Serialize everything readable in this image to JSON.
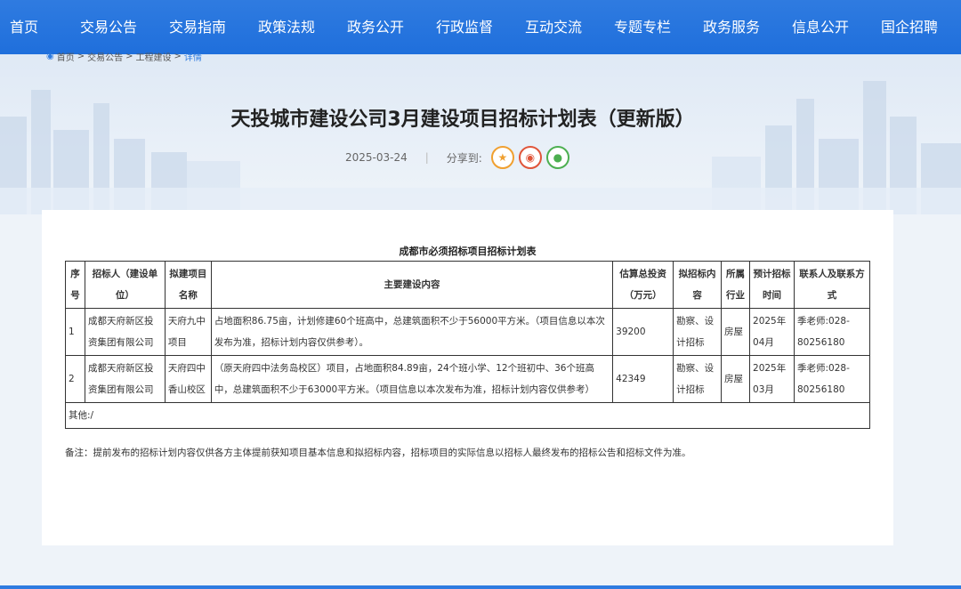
{
  "nav": {
    "items": [
      {
        "label": "首页"
      },
      {
        "label": "交易公告"
      },
      {
        "label": "交易指南"
      },
      {
        "label": "政策法规"
      },
      {
        "label": "政务公开"
      },
      {
        "label": "行政监督"
      },
      {
        "label": "互动交流"
      },
      {
        "label": "专题专栏"
      },
      {
        "label": "政务服务"
      },
      {
        "label": "信息公开"
      },
      {
        "label": "国企招聘"
      }
    ],
    "bg_color": "#2f7be0"
  },
  "breadcrumb": {
    "items": [
      "首页",
      "交易公告",
      "工程建设"
    ],
    "sep": ">",
    "current": "详情"
  },
  "article": {
    "title": "天投城市建设公司3月建设项目招标计划表（更新版）",
    "date": "2025-03-24",
    "sep": "|",
    "share_label": "分享到:",
    "share_icons": [
      "star-icon",
      "weibo-icon",
      "wechat-icon"
    ]
  },
  "table": {
    "caption": "成都市必须招标项目招标计划表",
    "headers": {
      "no": "序号",
      "owner": "招标人（建设单位）",
      "project": "拟建项目名称",
      "content": "主要建设内容",
      "invest": "估算总投资（万元）",
      "scope": "拟招标内容",
      "industry": "所属行业",
      "time": "预计招标时间",
      "contact": "联系人及联系方式"
    },
    "rows": [
      {
        "no": "1",
        "owner": "成都天府新区投资集团有限公司",
        "project": "天府九中项目",
        "content": "占地面积86.75亩，计划修建60个班高中，总建筑面积不少于56000平方米。（项目信息以本次发布为准，招标计划内容仅供参考）。",
        "invest": "39200",
        "scope": "勘察、设计招标",
        "industry": "房屋",
        "time": "2025年04月",
        "contact": "季老师:028-80256180"
      },
      {
        "no": "2",
        "owner": "成都天府新区投资集团有限公司",
        "project": "天府四中香山校区",
        "content": "（原天府四中法务岛校区）项目，占地面积84.89亩，24个班小学、12个班初中、36个班高中，总建筑面积不少于63000平方米。（项目信息以本次发布为准，招标计划内容仅供参考）",
        "invest": "42349",
        "scope": "勘察、设计招标",
        "industry": "房屋",
        "time": "2025年03月",
        "contact": "季老师:028-80256180"
      }
    ],
    "other": "其他:/"
  },
  "note": "备注：提前发布的招标计划内容仅供各方主体提前获知项目基本信息和拟招标内容，招标项目的实际信息以招标人最终发布的招标公告和招标文件为准。"
}
